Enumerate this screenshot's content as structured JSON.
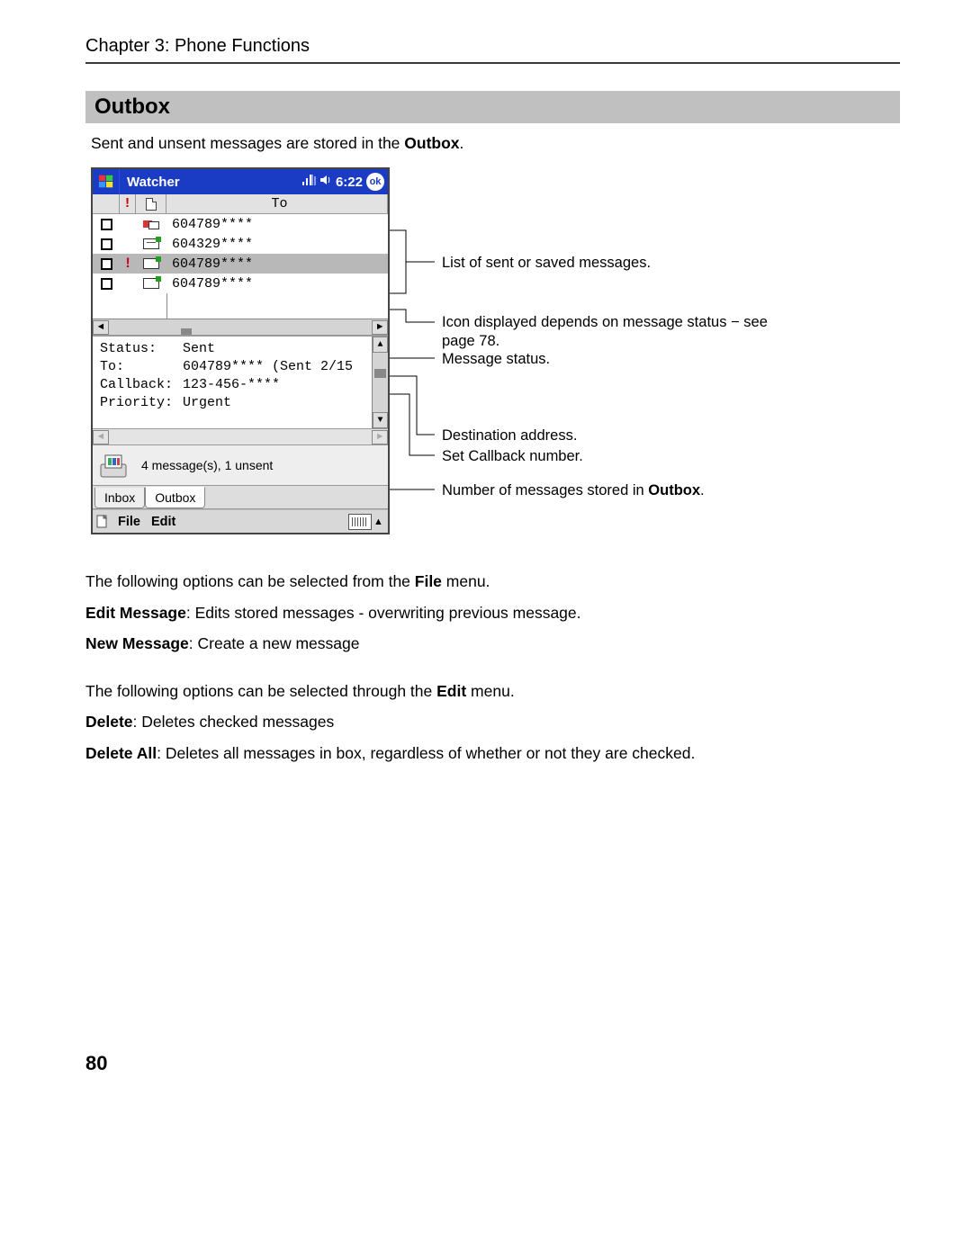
{
  "header": {
    "chapter": "Chapter 3: Phone Functions"
  },
  "section": {
    "title": "Outbox"
  },
  "intro": {
    "pre": "Sent and unsent messages are stored in the ",
    "bold": "Outbox",
    "post": "."
  },
  "device": {
    "titlebar": {
      "app": "Watcher",
      "time": "6:22",
      "ok": "ok"
    },
    "columns": {
      "to": "To"
    },
    "rows": [
      {
        "priority": "",
        "iconType": "flag",
        "to": "604789****",
        "selected": false
      },
      {
        "priority": "",
        "iconType": "draft",
        "to": "604329****",
        "selected": false
      },
      {
        "priority": "!",
        "iconType": "sent",
        "to": "604789****",
        "selected": true
      },
      {
        "priority": "",
        "iconType": "sent",
        "to": "604789****",
        "selected": false
      }
    ],
    "detail": {
      "status_label": "Status:",
      "status_value": "Sent",
      "to_label": "To:",
      "to_value": "604789**** (Sent 2/15",
      "callback_label": "Callback:",
      "callback_value": "123-456-****",
      "priority_label": "Priority:",
      "priority_value": "Urgent"
    },
    "summary": "4 message(s), 1 unsent",
    "tabs": {
      "inbox": "Inbox",
      "outbox": "Outbox"
    },
    "menu": {
      "file": "File",
      "edit": "Edit"
    }
  },
  "callouts": {
    "c1": "List of sent or saved messages.",
    "c2a": "Icon displayed depends on message status − see",
    "c2b": "page 78.",
    "c3": "Message status.",
    "c4": "Destination address.",
    "c5": "Set Callback number.",
    "c6_pre": "Number of messages stored in ",
    "c6_bold": "Outbox",
    "c6_post": "."
  },
  "body": {
    "p1_pre": "The following options can be selected from the ",
    "p1_bold": "File",
    "p1_post": " menu.",
    "p2_bold": "Edit Message",
    "p2_rest": ": Edits stored messages - overwriting previous message.",
    "p3_bold": "New Message",
    "p3_rest": ": Create a new message",
    "p4_pre": "The following options can be selected through the ",
    "p4_bold": "Edit",
    "p4_post": " menu.",
    "p5_bold": "Delete",
    "p5_rest": ": Deletes checked messages",
    "p6_bold": "Delete All",
    "p6_rest": ":  Deletes all messages in box, regardless of whether or not they are checked."
  },
  "pagenum": "80"
}
